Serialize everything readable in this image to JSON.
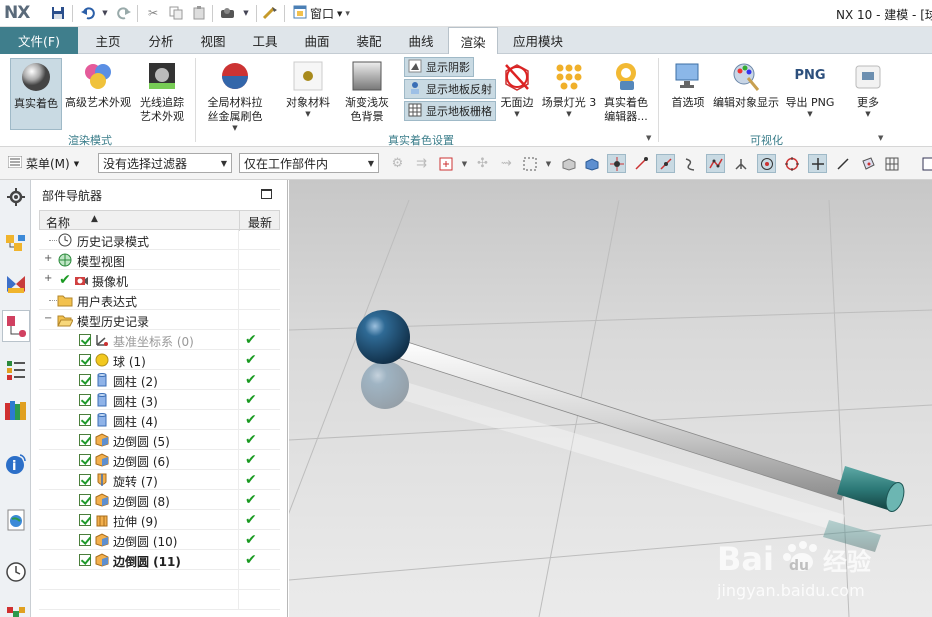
{
  "titlebar": {
    "logo": "NX",
    "window_menu": "窗口",
    "title": "NX 10 - 建模 - [球"
  },
  "tabs": {
    "file": "文件(F)",
    "items": [
      "主页",
      "分析",
      "视图",
      "工具",
      "曲面",
      "装配",
      "曲线",
      "渲染",
      "应用模块"
    ],
    "active": "渲染"
  },
  "ribbon": {
    "true_shading": "真实着色",
    "advanced_art": "高级艺术外观",
    "raytrace_1": "光线追踪",
    "raytrace_2": "艺术外观",
    "group_render_mode": "渲染模式",
    "global_mat_1": "全局材料拉",
    "global_mat_2": "丝金属刷色",
    "object_material": "对象材料",
    "gradient_1": "渐变浅灰",
    "gradient_2": "色背景",
    "show_shadow": "显示阴影",
    "show_floor_reflection": "显示地板反射",
    "show_floor_grid": "显示地板栅格",
    "no_face": "无面边",
    "scene_light": "场景灯光 3",
    "shading_editor_1": "真实着色",
    "shading_editor_2": "编辑器...",
    "group_true_shading": "真实着色设置",
    "preferences": "首选项",
    "edit_display": "编辑对象显示",
    "export_png": "导出 PNG",
    "png_label": "PNG",
    "more": "更多",
    "group_visualize": "可视化"
  },
  "selection_bar": {
    "menu": "菜单(M)",
    "filter": "没有选择过滤器",
    "scope": "仅在工作部件内"
  },
  "navigator": {
    "title": "部件导航器",
    "col_name": "名称",
    "col_latest": "最新",
    "rows": [
      {
        "label": "历史记录模式",
        "icon": "clock-icon"
      },
      {
        "label": "模型视图",
        "icon": "model-view-icon"
      },
      {
        "label": "摄像机",
        "icon": "camera-icon"
      },
      {
        "label": "用户表达式",
        "icon": "folder-icon"
      },
      {
        "label": "模型历史记录",
        "icon": "folder-open-icon"
      },
      {
        "label": "基准坐标系 (0)",
        "icon": "datum-csys-icon"
      },
      {
        "label": "球 (1)",
        "icon": "sphere-icon"
      },
      {
        "label": "圆柱 (2)",
        "icon": "cylinder-icon"
      },
      {
        "label": "圆柱 (3)",
        "icon": "cylinder-icon"
      },
      {
        "label": "圆柱 (4)",
        "icon": "cylinder-icon"
      },
      {
        "label": "边倒圆 (5)",
        "icon": "edge-blend-icon"
      },
      {
        "label": "边倒圆 (6)",
        "icon": "edge-blend-icon"
      },
      {
        "label": "旋转 (7)",
        "icon": "revolve-icon"
      },
      {
        "label": "边倒圆 (8)",
        "icon": "edge-blend-icon"
      },
      {
        "label": "拉伸 (9)",
        "icon": "extrude-icon"
      },
      {
        "label": "边倒圆 (10)",
        "icon": "edge-blend-icon"
      },
      {
        "label": "边倒圆 (11)",
        "icon": "edge-blend-icon"
      }
    ]
  },
  "watermark": {
    "brand": "Bai",
    "brand2": "du",
    "cn": "经验",
    "url": "jingyan.baidu.com"
  },
  "colors": {
    "accent": "#3f7e8c",
    "ball": "#1f4f72",
    "cap": "#2d7a78",
    "check": "#1a9a22"
  }
}
